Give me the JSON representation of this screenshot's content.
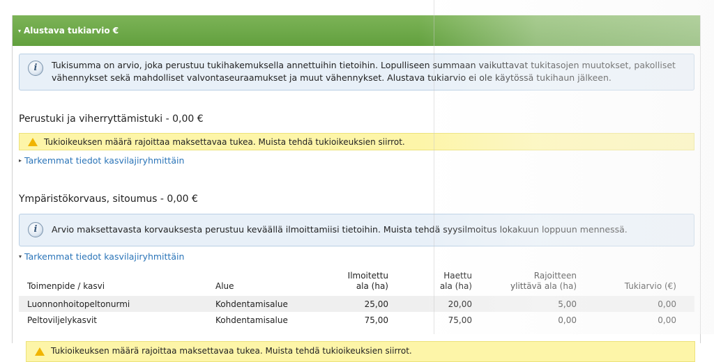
{
  "panel": {
    "title": "Alustava tukiarvio €",
    "info_text": "Tukisumma on arvio, joka perustuu tukihakemuksella annettuihin tietoihin. Lopulliseen summaan vaikuttavat tukitasojen muutokset, pakolliset vähennykset sekä mahdolliset valvontaseuraamukset ja muut vähennykset. Alustava tukiarvio ei ole käytössä tukihaun jälkeen."
  },
  "section1": {
    "title": "Perustuki ja viherryttämistuki - 0,00 €",
    "warning": "Tukioikeuksen määrä rajoittaa maksettavaa tukea. Muista tehdä tukioikeuksien siirrot.",
    "link": "Tarkemmat tiedot kasvilajiryhmittäin"
  },
  "section2": {
    "title": "Ympäristökorvaus, sitoumus - 0,00 €",
    "info_text": "Arvio maksettavasta korvauksesta perustuu keväällä ilmoittamiisi tietoihin. Muista tehdä syysilmoitus lokakuun loppuun mennessä.",
    "link": "Tarkemmat tiedot kasvilajiryhmittäin",
    "table": {
      "headers": {
        "toimenpide": "Toimenpide / kasvi",
        "alue": "Alue",
        "ilmoitettu_1": "Ilmoitettu",
        "ilmoitettu_2": "ala (ha)",
        "haettu_1": "Haettu",
        "haettu_2": "ala (ha)",
        "rajoitteen_1": "Rajoitteen",
        "rajoitteen_2": "ylittävä ala (ha)",
        "tukiarvio": "Tukiarvio (€)"
      },
      "rows": [
        {
          "toimenpide": "Luonnonhoitopeltonurmi",
          "alue": "Kohdentamisalue",
          "ilmoitettu": "25,00",
          "haettu": "20,00",
          "rajoitteen": "5,00",
          "tukiarvio": "0,00"
        },
        {
          "toimenpide": "Peltoviljelykasvit",
          "alue": "Kohdentamisalue",
          "ilmoitettu": "75,00",
          "haettu": "75,00",
          "rajoitteen": "0,00",
          "tukiarvio": "0,00"
        }
      ]
    }
  },
  "bottom_warning": "Tukioikeuksen määrä rajoittaa maksettavaa tukea. Muista tehdä tukioikeuksien siirrot."
}
